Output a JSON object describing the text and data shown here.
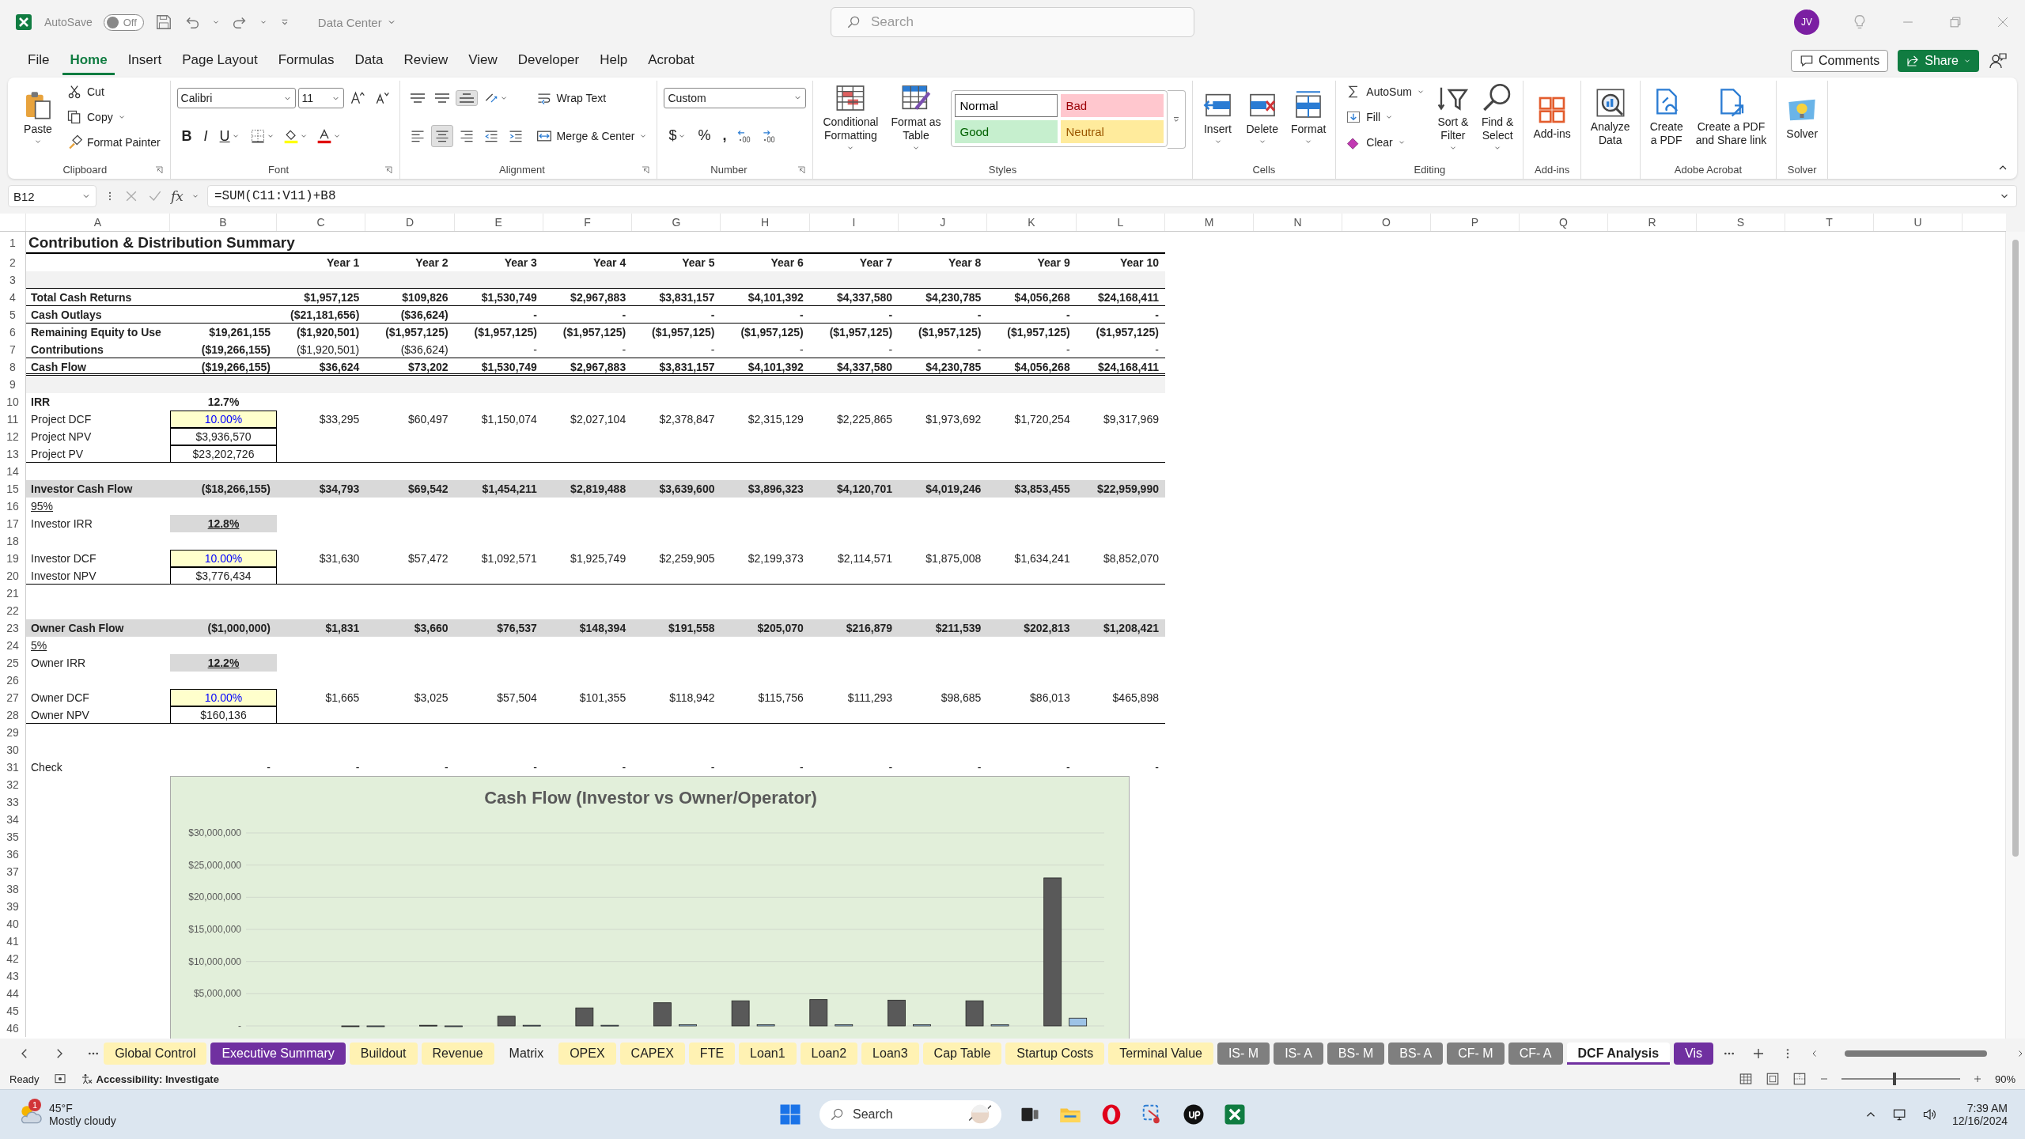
{
  "titlebar": {
    "autosave_label": "AutoSave",
    "autosave": {
      "on": false,
      "label": "Off"
    },
    "document": "Data Center",
    "search": {
      "placeholder": "Search"
    },
    "avatar": "JV"
  },
  "menu": {
    "tabs": [
      {
        "label": "File",
        "selected": false
      },
      {
        "label": "Home",
        "selected": true
      },
      {
        "label": "Insert",
        "selected": false
      },
      {
        "label": "Page Layout",
        "selected": false
      },
      {
        "label": "Formulas",
        "selected": false
      },
      {
        "label": "Data",
        "selected": false
      },
      {
        "label": "Review",
        "selected": false
      },
      {
        "label": "View",
        "selected": false
      },
      {
        "label": "Developer",
        "selected": false
      },
      {
        "label": "Help",
        "selected": false
      },
      {
        "label": "Acrobat",
        "selected": false
      }
    ],
    "comments": "Comments",
    "share": "Share"
  },
  "ribbon": {
    "groups": [
      {
        "label": "Clipboard",
        "columns": [
          [
            [
              {
                "kind": "paste",
                "label": "Paste"
              }
            ]
          ],
          [
            [
              {
                "kind": "cut",
                "label": "Cut"
              }
            ],
            [
              {
                "kind": "copy",
                "label": "Copy"
              }
            ],
            [
              {
                "kind": "format-painter",
                "label": "Format Painter"
              }
            ]
          ]
        ]
      },
      {
        "label": "Font",
        "columns": [
          [
            [
              {
                "kind": "font-select",
                "value": "Calibri"
              },
              {
                "kind": "size-select",
                "value": "11"
              },
              {
                "kind": "grow"
              },
              {
                "kind": "shrink"
              }
            ],
            [
              {
                "kind": "bold",
                "label": "B"
              },
              {
                "kind": "italic",
                "label": "I"
              },
              {
                "kind": "underline",
                "label": "U"
              },
              {
                "kind": "border"
              },
              {
                "kind": "fill-color"
              },
              {
                "kind": "font-color"
              }
            ]
          ]
        ]
      },
      {
        "label": "Alignment",
        "columns": [
          [
            [
              {
                "kind": "align-top",
                "selected": false
              },
              {
                "kind": "align-middle",
                "selected": false
              },
              {
                "kind": "align-bottom",
                "selected": true
              },
              {
                "kind": "orient"
              }
            ],
            [
              {
                "kind": "align-left",
                "selected": false
              },
              {
                "kind": "align-center",
                "selected": true
              },
              {
                "kind": "align-right",
                "selected": false
              },
              {
                "kind": "outdent"
              },
              {
                "kind": "indent"
              }
            ]
          ],
          [
            [
              {
                "kind": "wrap-text",
                "label": "Wrap Text"
              }
            ],
            [
              {
                "kind": "merge-center",
                "label": "Merge & Center"
              }
            ]
          ]
        ]
      },
      {
        "label": "Number",
        "columns": [
          [
            [
              {
                "kind": "format-select",
                "value": "Custom"
              }
            ],
            [
              {
                "kind": "currency",
                "label": "$"
              },
              {
                "kind": "percent",
                "label": "%"
              },
              {
                "kind": "comma",
                "label": ","
              },
              {
                "kind": "inc-decimal"
              },
              {
                "kind": "dec-decimal"
              }
            ]
          ]
        ]
      },
      {
        "label": "Styles",
        "columns": [
          [
            [
              {
                "kind": "conditional-formatting",
                "label": "Conditional\nFormatting"
              }
            ]
          ],
          [
            [
              {
                "kind": "format-as-table",
                "label": "Format as\nTable"
              }
            ]
          ],
          [
            [
              {
                "kind": "gallery",
                "styles": [
                  {
                    "label": "Normal",
                    "color": "#ffffff"
                  },
                  {
                    "label": "Bad",
                    "color": "#ffc7ce"
                  },
                  {
                    "label": "Good",
                    "color": "#c6efce"
                  },
                  {
                    "label": "Neutral",
                    "color": "#ffeb9c"
                  }
                ]
              }
            ]
          ]
        ]
      },
      {
        "label": "Cells",
        "columns": [
          [
            [
              {
                "kind": "insert",
                "label": "Insert"
              }
            ]
          ],
          [
            [
              {
                "kind": "delete",
                "label": "Delete"
              }
            ]
          ],
          [
            [
              {
                "kind": "format",
                "label": "Format"
              }
            ]
          ]
        ]
      },
      {
        "label": "Editing",
        "columns": [
          [
            [
              {
                "kind": "autosum",
                "label": "AutoSum"
              }
            ],
            [
              {
                "kind": "fill",
                "label": "Fill"
              }
            ],
            [
              {
                "kind": "clear",
                "label": "Clear"
              }
            ]
          ],
          [
            [
              {
                "kind": "sort-filter",
                "label": "Sort &\nFilter"
              }
            ]
          ],
          [
            [
              {
                "kind": "find-select",
                "label": "Find &\nSelect"
              }
            ]
          ]
        ]
      },
      {
        "label": "Add-ins",
        "columns": [
          [
            [
              {
                "kind": "add-ins",
                "label": "Add-ins"
              }
            ]
          ]
        ]
      },
      {
        "columns": [
          [
            [
              {
                "kind": "analyze-data",
                "label": "Analyze\nData"
              }
            ]
          ]
        ]
      },
      {
        "label": "Adobe Acrobat",
        "columns": [
          [
            [
              {
                "kind": "create-pdf",
                "label": "Create\na PDF"
              }
            ]
          ],
          [
            [
              {
                "kind": "create-pdf-share",
                "label": "Create a PDF\nand Share link"
              }
            ]
          ]
        ]
      },
      {
        "label": "Solver",
        "columns": [
          [
            [
              {
                "kind": "solver",
                "label": "Solver"
              }
            ]
          ]
        ]
      }
    ]
  },
  "formula_bar": {
    "name_box": "B12",
    "fx": "fx",
    "formula": "=SUM(C11:V11)+B8"
  },
  "sheet": {
    "columns": [
      "A",
      "B",
      "C",
      "D",
      "E",
      "F",
      "G",
      "H",
      "I",
      "J",
      "K",
      "L",
      "M",
      "N",
      "O",
      "P",
      "Q",
      "R",
      "S",
      "T",
      "U"
    ],
    "rows": [
      {
        "n": "1",
        "kind": "title",
        "ruled": true,
        "label": "Contribution & Distribution Summary"
      },
      {
        "n": "2",
        "kind": "header",
        "years": [
          "Year 1",
          "Year 2",
          "Year 3",
          "Year 4",
          "Year 5",
          "Year 6",
          "Year 7",
          "Year 8",
          "Year 9",
          "Year 10"
        ]
      },
      {
        "n": "3",
        "kind": "band",
        "ruled": true
      },
      {
        "n": "4",
        "kind": "bold",
        "ruled": true,
        "label": "Total Cash Returns",
        "years": [
          "$1,957,125",
          "$109,826",
          "$1,530,749",
          "$2,967,883",
          "$3,831,157",
          "$4,101,392",
          "$4,337,580",
          "$4,230,785",
          "$4,056,268",
          "$24,168,411"
        ]
      },
      {
        "n": "5",
        "kind": "bold",
        "ruled": true,
        "label": "Cash Outlays",
        "years": [
          "($21,181,656)",
          "($36,624)",
          "-",
          "-",
          "-",
          "-",
          "-",
          "-",
          "-",
          "-"
        ]
      },
      {
        "n": "6",
        "kind": "bold",
        "label": "Remaining Equity to Use",
        "b": {
          "text": "$19,261,155",
          "kind": "right"
        },
        "years": [
          "($1,920,501)",
          "($1,957,125)",
          "($1,957,125)",
          "($1,957,125)",
          "($1,957,125)",
          "($1,957,125)",
          "($1,957,125)",
          "($1,957,125)",
          "($1,957,125)",
          "($1,957,125)"
        ]
      },
      {
        "n": "7",
        "kind": "mixed",
        "ruled": true,
        "label": "Contributions",
        "b": {
          "text": "($19,266,155)",
          "kind": "right"
        },
        "years": [
          "($1,920,501)",
          "($36,624)",
          "-",
          "-",
          "-",
          "-",
          "-",
          "-",
          "-",
          "-"
        ]
      },
      {
        "n": "8",
        "kind": "bold",
        "ruled": true,
        "double_ruled": true,
        "label": "Cash Flow",
        "b": {
          "text": "($19,266,155)",
          "kind": "right"
        },
        "years": [
          "$36,624",
          "$73,202",
          "$1,530,749",
          "$2,967,883",
          "$3,831,157",
          "$4,101,392",
          "$4,337,580",
          "$4,230,785",
          "$4,056,268",
          "$24,168,411"
        ]
      },
      {
        "n": "9",
        "kind": "band"
      },
      {
        "n": "10",
        "kind": "bold",
        "label": "IRR",
        "b": {
          "text": "12.7%",
          "kind": "center"
        }
      },
      {
        "n": "11",
        "kind": "plain",
        "label": "Project DCF",
        "b": {
          "text": "10.00%",
          "kind": "input"
        },
        "years": [
          "$33,295",
          "$60,497",
          "$1,150,074",
          "$2,027,104",
          "$2,378,847",
          "$2,315,129",
          "$2,225,865",
          "$1,973,692",
          "$1,720,254",
          "$9,317,969"
        ]
      },
      {
        "n": "12",
        "kind": "plain",
        "label": "Project NPV",
        "b": {
          "text": "$3,936,570",
          "kind": "boxed"
        }
      },
      {
        "n": "13",
        "kind": "plain",
        "ruled": true,
        "label": "Project PV",
        "b": {
          "text": "$23,202,726",
          "kind": "boxed"
        }
      },
      {
        "n": "14",
        "kind": "plain"
      },
      {
        "n": "15",
        "kind": "shaded",
        "label": "Investor Cash Flow",
        "b": {
          "text": "($18,266,155)",
          "kind": "right"
        },
        "years": [
          "$34,793",
          "$69,542",
          "$1,454,211",
          "$2,819,488",
          "$3,639,600",
          "$3,896,323",
          "$4,120,701",
          "$4,019,246",
          "$3,853,455",
          "$22,959,990"
        ]
      },
      {
        "n": "16",
        "kind": "link",
        "label": "95%"
      },
      {
        "n": "17",
        "kind": "plain",
        "label": "Investor IRR",
        "b": {
          "text": "12.8%",
          "kind": "shaded"
        }
      },
      {
        "n": "18",
        "kind": "plain"
      },
      {
        "n": "19",
        "kind": "plain",
        "label": "Investor DCF",
        "b": {
          "text": "10.00%",
          "kind": "input"
        },
        "years": [
          "$31,630",
          "$57,472",
          "$1,092,571",
          "$1,925,749",
          "$2,259,905",
          "$2,199,373",
          "$2,114,571",
          "$1,875,008",
          "$1,634,241",
          "$8,852,070"
        ]
      },
      {
        "n": "20",
        "kind": "plain",
        "ruled": true,
        "label": "Investor NPV",
        "b": {
          "text": "$3,776,434",
          "kind": "boxed"
        }
      },
      {
        "n": "21",
        "kind": "plain"
      },
      {
        "n": "22",
        "kind": "plain"
      },
      {
        "n": "23",
        "kind": "shaded",
        "label": "Owner Cash Flow",
        "b": {
          "text": "($1,000,000)",
          "kind": "right"
        },
        "years": [
          "$1,831",
          "$3,660",
          "$76,537",
          "$148,394",
          "$191,558",
          "$205,070",
          "$216,879",
          "$211,539",
          "$202,813",
          "$1,208,421"
        ]
      },
      {
        "n": "24",
        "kind": "link",
        "label": "5%"
      },
      {
        "n": "25",
        "kind": "plain",
        "label": "Owner IRR",
        "b": {
          "text": "12.2%",
          "kind": "shaded"
        }
      },
      {
        "n": "26",
        "kind": "plain"
      },
      {
        "n": "27",
        "kind": "plain",
        "label": "Owner DCF",
        "b": {
          "text": "10.00%",
          "kind": "input"
        },
        "years": [
          "$1,665",
          "$3,025",
          "$57,504",
          "$101,355",
          "$118,942",
          "$115,756",
          "$111,293",
          "$98,685",
          "$86,013",
          "$465,898"
        ]
      },
      {
        "n": "28",
        "kind": "plain",
        "ruled": true,
        "label": "Owner NPV",
        "b": {
          "text": "$160,136",
          "kind": "boxed"
        }
      },
      {
        "n": "29",
        "kind": "plain"
      },
      {
        "n": "30",
        "kind": "plain"
      },
      {
        "n": "31",
        "kind": "plain",
        "label": "Check",
        "b": {
          "text": "-",
          "kind": "right"
        },
        "years": [
          "-",
          "-",
          "-",
          "-",
          "-",
          "-",
          "-",
          "-",
          "-",
          "-"
        ]
      },
      {
        "n": "32",
        "kind": "plain"
      },
      {
        "n": "33",
        "kind": "plain"
      },
      {
        "n": "34",
        "kind": "plain"
      },
      {
        "n": "35",
        "kind": "plain"
      },
      {
        "n": "36",
        "kind": "plain"
      },
      {
        "n": "37",
        "kind": "plain"
      },
      {
        "n": "38",
        "kind": "plain"
      },
      {
        "n": "39",
        "kind": "plain"
      },
      {
        "n": "40",
        "kind": "plain"
      },
      {
        "n": "41",
        "kind": "plain"
      },
      {
        "n": "42",
        "kind": "plain"
      },
      {
        "n": "43",
        "kind": "plain"
      },
      {
        "n": "44",
        "kind": "plain"
      },
      {
        "n": "45",
        "kind": "plain"
      },
      {
        "n": "46",
        "kind": "plain"
      }
    ],
    "chart": {
      "chart_data": {
        "type": "bar",
        "title": "Cash Flow (Investor vs Owner/Operator)",
        "grid": true,
        "series": [
          {
            "color": "#595959",
            "values": [
              null,
              0,
              100000,
              1500000,
              2800000,
              3600000,
              3900000,
              4100000,
              4000000,
              3900000,
              23000000
            ]
          },
          {
            "color": "#9dc3e6",
            "values": [
              null,
              0,
              0,
              100000,
              100000,
              200000,
              200000,
              200000,
              200000,
              200000,
              1200000
            ]
          }
        ],
        "ylim": [
          0,
          30000000
        ],
        "yticks": [
          {
            "value": 0,
            "label": "-"
          },
          {
            "value": 5000000,
            "label": "$5,000,000"
          },
          {
            "value": 10000000,
            "label": "$10,000,000"
          },
          {
            "value": 15000000,
            "label": "$15,000,000"
          },
          {
            "value": 20000000,
            "label": "$20,000,000"
          },
          {
            "value": 25000000,
            "label": "$25,000,000"
          },
          {
            "value": 30000000,
            "label": "$30,000,000"
          }
        ]
      }
    }
  },
  "sheet_tabs": [
    {
      "label": "Global Control",
      "color": "#fff2b3",
      "selected": false
    },
    {
      "label": "Executive Summary",
      "color": "#7030a0",
      "selected": false
    },
    {
      "label": "Buildout",
      "color": "#fff2b3",
      "selected": false
    },
    {
      "label": "Revenue",
      "color": "#fff2b3",
      "selected": false
    },
    {
      "label": "Matrix",
      "selected": false
    },
    {
      "label": "OPEX",
      "color": "#fff2b3",
      "selected": false
    },
    {
      "label": "CAPEX",
      "color": "#fff2b3",
      "selected": false
    },
    {
      "label": "FTE",
      "color": "#fff2b3",
      "selected": false
    },
    {
      "label": "Loan1",
      "color": "#fff2b3",
      "selected": false
    },
    {
      "label": "Loan2",
      "color": "#fff2b3",
      "selected": false
    },
    {
      "label": "Loan3",
      "color": "#fff2b3",
      "selected": false
    },
    {
      "label": "Cap Table",
      "color": "#fff2b3",
      "selected": false
    },
    {
      "label": "Startup Costs",
      "color": "#fff2b3",
      "selected": false
    },
    {
      "label": "Terminal Value",
      "color": "#fff2b3",
      "selected": false
    },
    {
      "label": "IS- M",
      "color": "#7f7f7f",
      "selected": false
    },
    {
      "label": "IS- A",
      "color": "#7f7f7f",
      "selected": false
    },
    {
      "label": "BS- M",
      "color": "#7f7f7f",
      "selected": false
    },
    {
      "label": "BS- A",
      "color": "#7f7f7f",
      "selected": false
    },
    {
      "label": "CF- M",
      "color": "#7f7f7f",
      "selected": false
    },
    {
      "label": "CF- A",
      "color": "#7f7f7f",
      "selected": false
    },
    {
      "label": "DCF Analysis",
      "color": "#7030a0",
      "selected": true
    },
    {
      "label": "Vis",
      "color": "#7030a0",
      "selected": false
    }
  ],
  "status_bar": {
    "status": "Ready",
    "accessibility": "Accessibility: Investigate",
    "zoom": {
      "level": 0.45,
      "label": "90%"
    }
  },
  "taskbar": {
    "weather": {
      "badge": "1",
      "temperature": "45°F",
      "condition": "Mostly cloudy"
    },
    "search": {
      "placeholder": "Search"
    },
    "time": "7:39 AM",
    "date": "12/16/2024"
  }
}
